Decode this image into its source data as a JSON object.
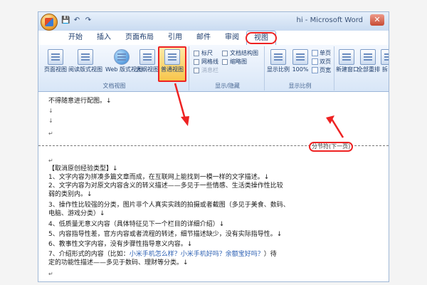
{
  "window": {
    "title": "hi - Microsoft Word",
    "close_icon": "✕"
  },
  "qat": {
    "save_icon": "💾",
    "undo_icon": "↶",
    "redo_icon": "↷"
  },
  "tabs": [
    {
      "label": "开始"
    },
    {
      "label": "插入"
    },
    {
      "label": "页面布局"
    },
    {
      "label": "引用"
    },
    {
      "label": "邮件"
    },
    {
      "label": "审阅"
    },
    {
      "label": "视图"
    }
  ],
  "ribbon": {
    "doc_views": {
      "label": "文档视图",
      "buttons": [
        "页面视图",
        "阅读版式视图",
        "Web 版式视图",
        "大纲视图",
        "普通视图"
      ]
    },
    "show_hide": {
      "label": "显示/隐藏",
      "checks": [
        "标尺",
        "网格线",
        "消息栏",
        "文档结构图",
        "缩略图"
      ]
    },
    "zoom": {
      "label": "显示比例",
      "buttons": [
        "显示比例",
        "100%"
      ],
      "small": [
        "单页",
        "双页",
        "页宽"
      ]
    },
    "window_group": {
      "buttons": [
        "新建窗口",
        "全部重排",
        "拆"
      ]
    }
  },
  "document": {
    "top_lines": [
      "不得随意进行配图。↓",
      "↓",
      "↓",
      "↵"
    ],
    "section_break_label": "分节符(下一页)",
    "lines": [
      "↵",
      "【取消原创经验类型】↓",
      "1、文字内容为拼凑多篇文章而成，在互联网上能找到一模一样的文字描述。↓",
      "2、文字内容为对原文内容含义的转义描述——多见于一些情感、生活类操作性比较",
      "弱的类别内。↓",
      "3、操作性比较强的分类，图片非个人真实实践的拍摄或者截图（多见于美食、数码、",
      "电脑、游戏分类）↓",
      "4、低质量无意义内容（具体特征见下一个栏目的详细介绍）↓",
      "5、内容指导性差，官方内容或者流程的转述，细节描述缺少，没有实际指导性。↓",
      "6、教事性文字内容，没有步骤性指导意义内容。↓"
    ],
    "line7_a": "7、介绍形式的内容（比如：",
    "line7_link": "小米手机怎么样？小米手机好吗？余额宝好吗？",
    "line7_b": "）待",
    "line8": "定的功能性描述——多见于数码、理财等分类。↓",
    "last": "↵"
  },
  "colors": {
    "annotation": "#ee2222",
    "selected_button": "#f7c54b",
    "ribbon": "#d8e6f7"
  }
}
